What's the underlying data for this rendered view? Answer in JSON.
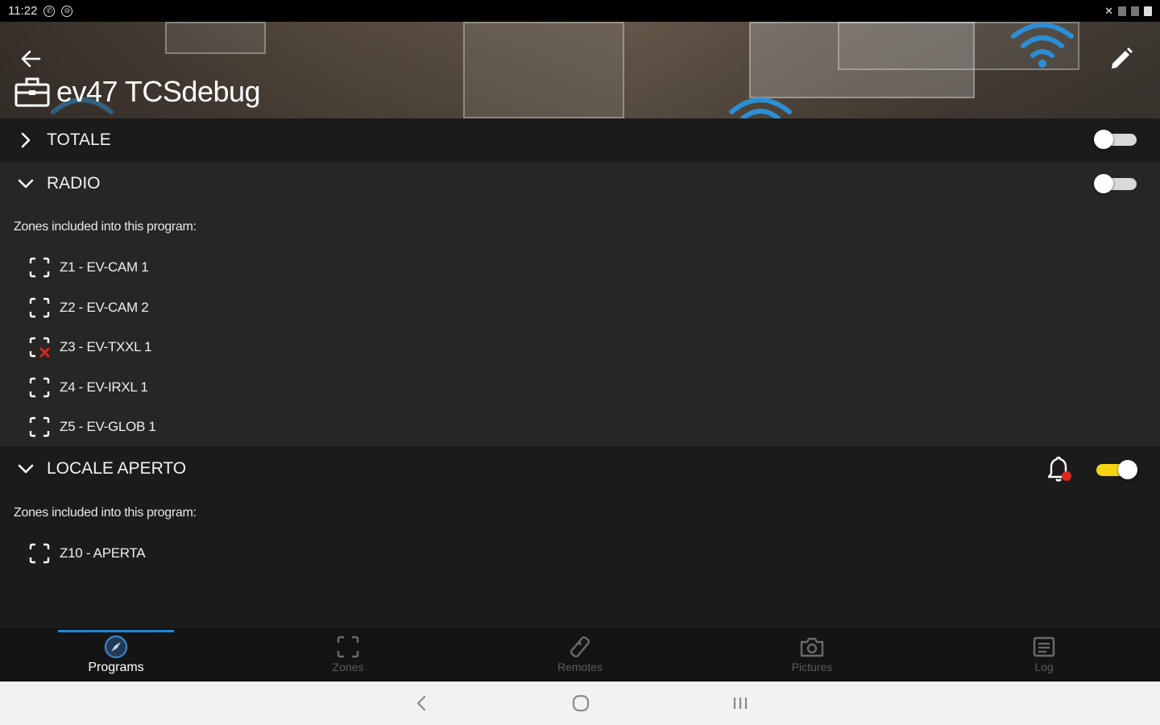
{
  "status_bar": {
    "time": "11:22"
  },
  "header": {
    "title": "ev47 TCSdebug",
    "icons": [
      "arrow-back-icon",
      "control-panel-icon",
      "pencil-icon"
    ]
  },
  "programs": [
    {
      "name": "TOTALE",
      "expanded": false,
      "enabled": false,
      "zones_caption": "",
      "zones": []
    },
    {
      "name": "RADIO",
      "expanded": true,
      "enabled": false,
      "zones_caption": "Zones included into this program:",
      "zones": [
        {
          "label": "Z1 - EV-CAM 1",
          "alert": false
        },
        {
          "label": "Z2 - EV-CAM 2",
          "alert": false
        },
        {
          "label": "Z3 - EV-TXXL 1",
          "alert": true
        },
        {
          "label": "Z4 - EV-IRXL 1",
          "alert": false
        },
        {
          "label": "Z5 - EV-GLOB 1",
          "alert": false
        }
      ]
    },
    {
      "name": "LOCALE APERTO",
      "expanded": true,
      "enabled": true,
      "has_alarm_badge": true,
      "zones_caption": "Zones included into this program:",
      "zones": [
        {
          "label": "Z10 - APERTA",
          "alert": false
        }
      ]
    }
  ],
  "bottom_nav": {
    "items": [
      {
        "label": "Programs",
        "icon": "compass-icon",
        "active": true
      },
      {
        "label": "Zones",
        "icon": "zones-icon",
        "active": false
      },
      {
        "label": "Remotes",
        "icon": "remote-icon",
        "active": false
      },
      {
        "label": "Pictures",
        "icon": "camera-icon",
        "active": false
      },
      {
        "label": "Log",
        "icon": "log-icon",
        "active": false
      }
    ]
  },
  "colors": {
    "accent_blue": "#1e88d6",
    "toggle_on": "#f5d312",
    "alert_red": "#e0261c",
    "section_dark": "#1b1b1b",
    "section_mid": "#262626"
  }
}
